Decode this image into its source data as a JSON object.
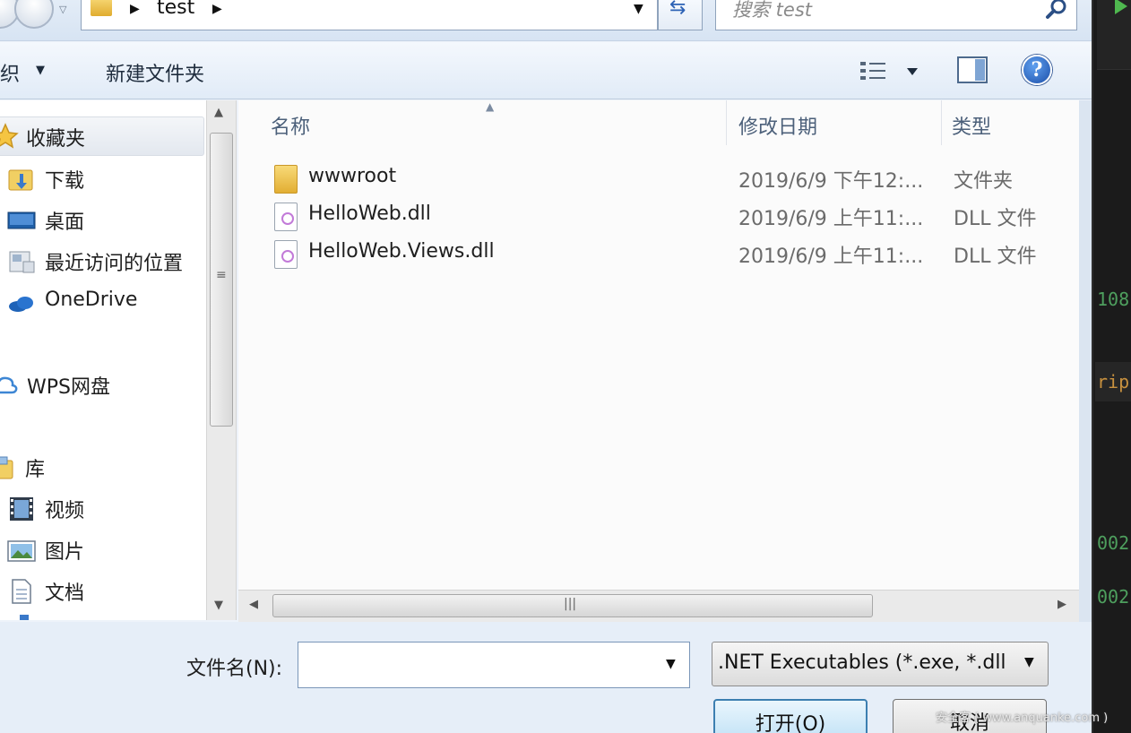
{
  "address_bar": {
    "path_segment": "test",
    "search_placeholder": "搜索 test"
  },
  "command_bar": {
    "organize_label": "组织",
    "new_folder_label": "新建文件夹"
  },
  "nav_pane": {
    "items": [
      {
        "label": "收藏夹",
        "icon": "star-icon"
      },
      {
        "label": "下载",
        "icon": "download-folder-icon"
      },
      {
        "label": "桌面",
        "icon": "desktop-icon"
      },
      {
        "label": "最近访问的位置",
        "icon": "recent-places-icon"
      },
      {
        "label": "OneDrive",
        "icon": "onedrive-cloud-icon"
      },
      {
        "label": "WPS网盘",
        "icon": "wps-cloud-icon"
      },
      {
        "label": "库",
        "icon": "library-icon"
      },
      {
        "label": "视频",
        "icon": "video-icon"
      },
      {
        "label": "图片",
        "icon": "picture-icon"
      },
      {
        "label": "文档",
        "icon": "document-icon"
      }
    ]
  },
  "file_list": {
    "columns": [
      "名称",
      "修改日期",
      "类型"
    ],
    "rows": [
      {
        "name": "wwwroot",
        "date": "2019/6/9 下午12:...",
        "type": "文件夹",
        "icon": "folder-icon"
      },
      {
        "name": "HelloWeb.dll",
        "date": "2019/6/9 上午11:...",
        "type": "DLL 文件",
        "icon": "dll-file-icon"
      },
      {
        "name": "HelloWeb.Views.dll",
        "date": "2019/6/9 上午11:...",
        "type": "DLL 文件",
        "icon": "dll-file-icon"
      }
    ]
  },
  "bottom": {
    "filename_label": "文件名(N):",
    "filename_value": "",
    "filter_label": ".NET Executables (*.exe, *.dll",
    "open_label": "打开(O)",
    "cancel_label": "取消"
  },
  "watermark": "安全客 ( www.anquanke.com )",
  "editor_fragments": [
    "108",
    "rip",
    "002",
    "002"
  ],
  "colors": {
    "accent": "#3c7fb1",
    "editor_text_green": "#4e9f5e",
    "editor_text_orange": "#c8913f",
    "run_green": "#4fb84f"
  }
}
